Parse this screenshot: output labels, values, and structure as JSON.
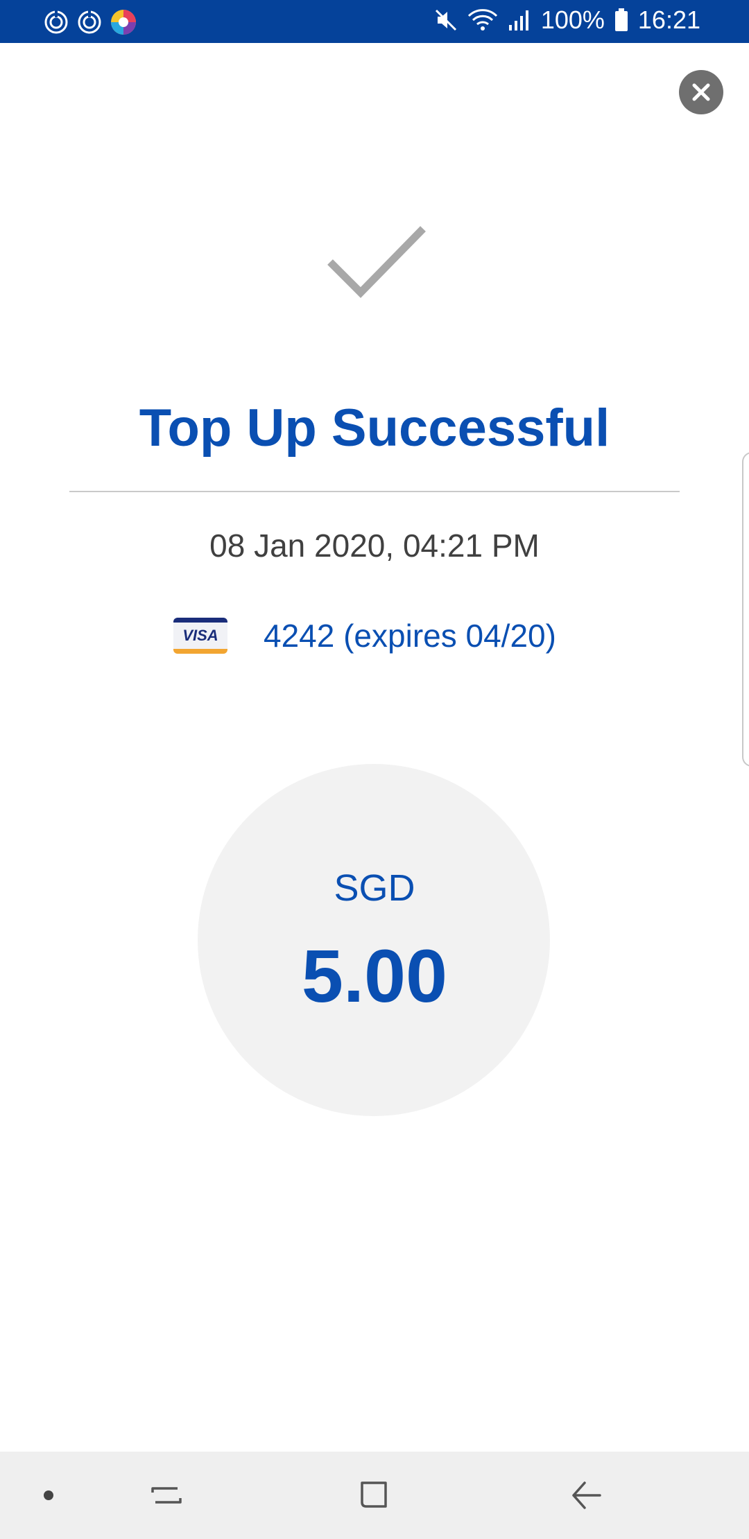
{
  "status_bar": {
    "battery_text": "100%",
    "time": "16:21",
    "background_color": "#05429a",
    "left_icons": [
      "sync-icon",
      "sync-icon",
      "browser-app-icon"
    ],
    "right_icons": [
      "mute-icon",
      "wifi-icon",
      "signal-icon",
      "battery-icon"
    ]
  },
  "header": {
    "close_icon": "close-icon"
  },
  "result": {
    "status_icon": "checkmark-icon",
    "title": "Top Up Successful",
    "datetime": "08 Jan 2020, 04:21 PM",
    "card": {
      "brand_label": "VISA",
      "text": "4242 (expires 04/20)"
    },
    "currency": "SGD",
    "amount": "5.00"
  },
  "nav_bar": {
    "items": [
      "dot-icon",
      "recent-apps-icon",
      "home-icon",
      "back-icon"
    ]
  },
  "colors": {
    "accent_blue": "#0a4fb2",
    "status_bar": "#05429a",
    "circle_bg": "#f2f2f2",
    "close_bg": "#6f6f6f"
  }
}
